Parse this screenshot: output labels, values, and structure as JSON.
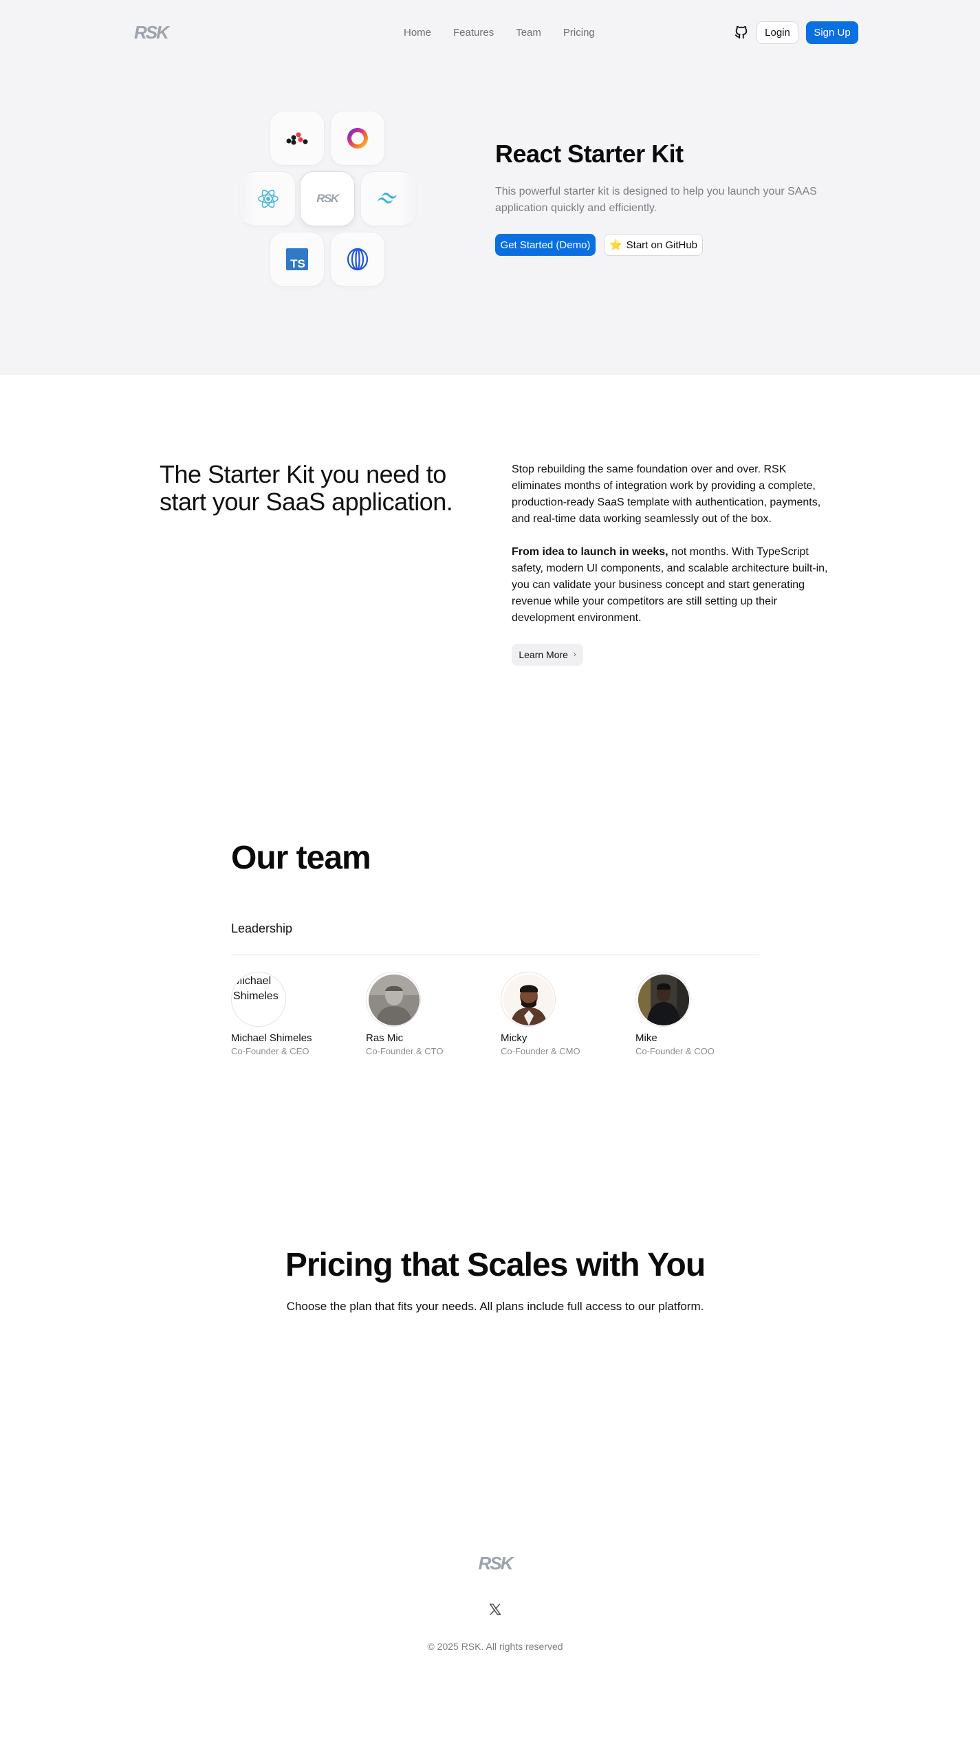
{
  "header": {
    "logo": "RSK",
    "nav": [
      "Home",
      "Features",
      "Team",
      "Pricing"
    ],
    "login_label": "Login",
    "signup_label": "Sign Up"
  },
  "hero": {
    "tile_logo": "RSK",
    "title": "React Starter Kit",
    "description": "This powerful starter kit is designed to help you launch your SAAS application quickly and efficiently.",
    "primary_cta": "Get Started (Demo)",
    "secondary_cta": "Start on GitHub",
    "secondary_cta_emoji": "⭐",
    "tech_icons": [
      "convex-icon",
      "clerk-icon",
      "react-icon",
      "rsk-icon",
      "tailwind-icon",
      "typescript-icon",
      "openai-icon"
    ],
    "typescript_badge": "TS"
  },
  "starter": {
    "heading": "The Starter Kit you need to start your SaaS application.",
    "paragraph1": "Stop rebuilding the same foundation over and over. RSK eliminates months of integration work by providing a complete, production-ready SaaS template with authentication, payments, and real-time data working seamlessly out of the box.",
    "paragraph2_bold": "From idea to launch in weeks,",
    "paragraph2_rest": " not months. With TypeScript safety, modern UI components, and scalable architecture built-in, you can validate your business concept and start generating revenue while your competitors are still setting up their development environment.",
    "learn_more": "Learn More",
    "learn_more_chevron": "›"
  },
  "team": {
    "title": "Our team",
    "subtitle": "Leadership",
    "members": [
      {
        "name": "Michael Shimeles",
        "role": "Co-Founder & CEO",
        "alt": "Michael Shimeles"
      },
      {
        "name": "Ras Mic",
        "role": "Co-Founder & CTO"
      },
      {
        "name": "Micky",
        "role": "Co-Founder & CMO"
      },
      {
        "name": "Mike",
        "role": "Co-Founder & COO"
      }
    ]
  },
  "pricing": {
    "title": "Pricing that Scales with You",
    "subtitle": "Choose the plan that fits your needs. All plans include full access to our platform."
  },
  "footer": {
    "logo": "RSK",
    "copyright": "© 2025 RSK. All rights reserved"
  },
  "colors": {
    "accent": "#0a6fe0",
    "hero_bg": "#f4f4f6",
    "muted_text": "#7a7e85",
    "logo_gray": "#9ba3ad"
  }
}
